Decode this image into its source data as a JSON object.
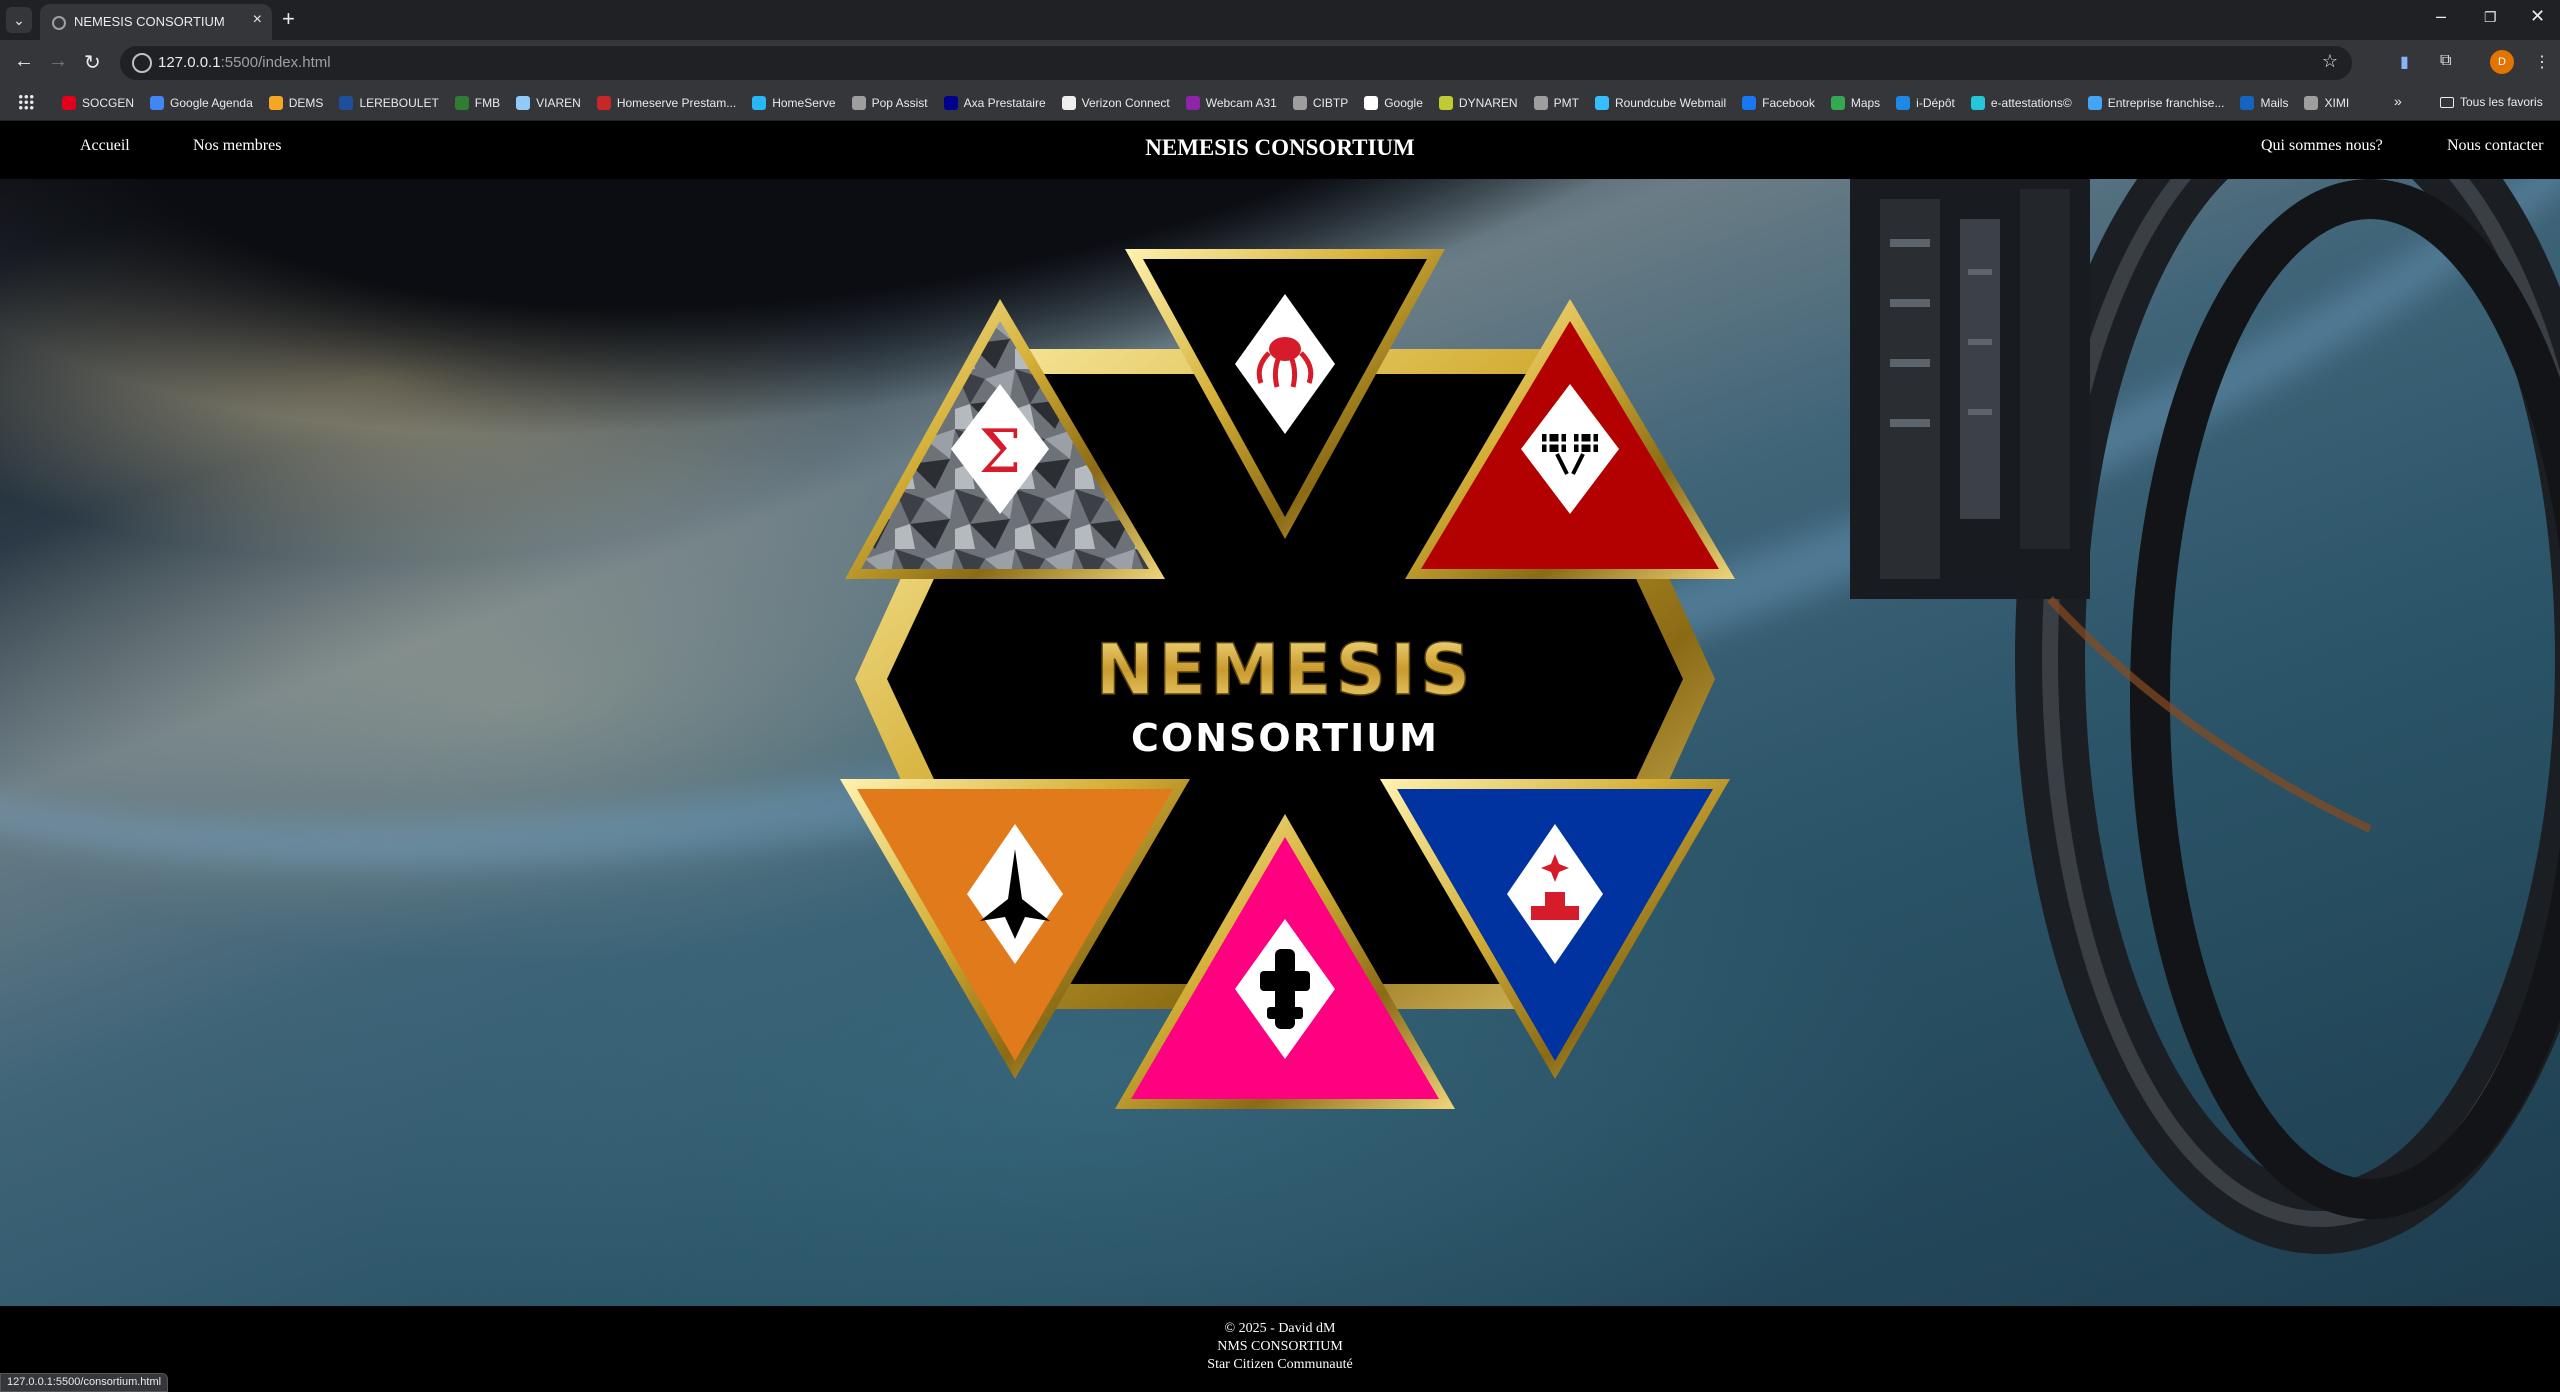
{
  "browser": {
    "tab_title": "NEMESIS CONSORTIUM",
    "url_host": "127.0.0.1",
    "url_rest": ":5500/index.html",
    "profile_initial": "D",
    "bookmarks": [
      {
        "label": "SOCGEN",
        "color": "#e2001a"
      },
      {
        "label": "Google Agenda",
        "color": "#4285f4"
      },
      {
        "label": "DEMS",
        "color": "#f5a623"
      },
      {
        "label": "LEREBOULET",
        "color": "#1f4e9c"
      },
      {
        "label": "FMB",
        "color": "#2e7d32"
      },
      {
        "label": "VIAREN",
        "color": "#90caf9"
      },
      {
        "label": "Homeserve Prestam...",
        "color": "#c62828"
      },
      {
        "label": "HomeServe",
        "color": "#29b6f6"
      },
      {
        "label": "Pop Assist",
        "color": "#9e9e9e"
      },
      {
        "label": "Axa Prestataire",
        "color": "#00008f"
      },
      {
        "label": "Verizon Connect",
        "color": "#eeeeee"
      },
      {
        "label": "Webcam A31",
        "color": "#8e24aa"
      },
      {
        "label": "CIBTP",
        "color": "#9e9e9e"
      },
      {
        "label": "Google",
        "color": "#ffffff"
      },
      {
        "label": "DYNAREN",
        "color": "#c0ca33"
      },
      {
        "label": "PMT",
        "color": "#9e9e9e"
      },
      {
        "label": "Roundcube Webmail",
        "color": "#37beff"
      },
      {
        "label": "Facebook",
        "color": "#1877f2"
      },
      {
        "label": "Maps",
        "color": "#34a853"
      },
      {
        "label": "i-Dépôt",
        "color": "#1e88e5"
      },
      {
        "label": "e-attestations©",
        "color": "#26c6da"
      },
      {
        "label": "Entreprise franchise...",
        "color": "#42a5f5"
      },
      {
        "label": "Mails",
        "color": "#1565c0"
      },
      {
        "label": "XIMI",
        "color": "#9e9e9e"
      }
    ],
    "all_bookmarks_label": "Tous les favoris",
    "status_url": "127.0.0.1:5500/consortium.html"
  },
  "site": {
    "title": "NEMESIS CONSORTIUM",
    "nav_left": [
      "Accueil",
      "Nos membres"
    ],
    "nav_right": [
      "Qui sommes nous?",
      "Nous contacter"
    ],
    "emblem": {
      "line1": "NEMESIS",
      "line2": "CONSORTIUM",
      "colors": {
        "gold": "#d4af37",
        "top": "#000000",
        "top_right": "#b30000",
        "bottom_right": "#0033a0",
        "bottom": "#ff0080",
        "bottom_left": "#e07a1a",
        "top_left": "#5a5f66"
      },
      "icons": [
        "sigma-icon",
        "spider-icon",
        "checkered-flags-icon",
        "spaceship-icon",
        "freighter-icon",
        "mining-icon"
      ]
    },
    "footer": [
      "© 2025 - David dM",
      "NMS CONSORTIUM",
      "Star Citizen Communauté"
    ]
  }
}
